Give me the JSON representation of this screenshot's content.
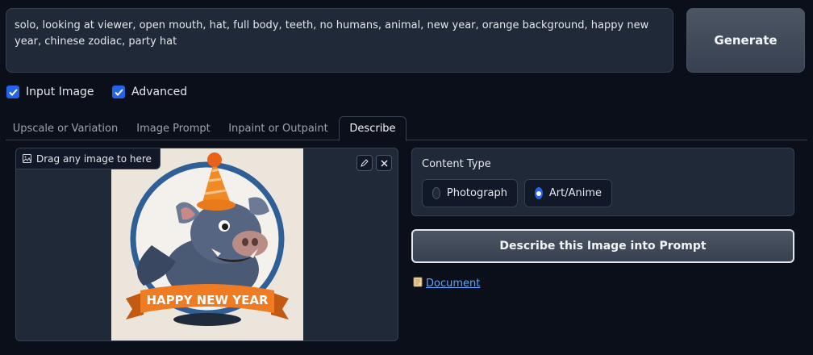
{
  "prompt": {
    "text": "solo, looking at viewer, open mouth, hat, full body, teeth, no humans, animal, new year, orange background, happy new year, chinese zodiac, party hat"
  },
  "generate_button": {
    "label": "Generate"
  },
  "options": {
    "input_image": {
      "label": "Input Image",
      "checked": true
    },
    "advanced": {
      "label": "Advanced",
      "checked": true
    }
  },
  "tabs": [
    {
      "label": "Upscale or Variation"
    },
    {
      "label": "Image Prompt"
    },
    {
      "label": "Inpaint or Outpaint"
    },
    {
      "label": "Describe",
      "active": true
    }
  ],
  "image_upload": {
    "drop_label": "Drag any image to here",
    "banner_text": "HAPPY NEW YEAR"
  },
  "content_type": {
    "label": "Content Type",
    "options": [
      {
        "label": "Photograph",
        "selected": false
      },
      {
        "label": "Art/Anime",
        "selected": true
      }
    ]
  },
  "describe_button": {
    "label": "Describe this Image into Prompt"
  },
  "document_link": {
    "label": "Document"
  },
  "colors": {
    "accent": "#2563eb",
    "link": "#60a5fa",
    "background": "#0b0f19",
    "panel": "#1f2937"
  }
}
